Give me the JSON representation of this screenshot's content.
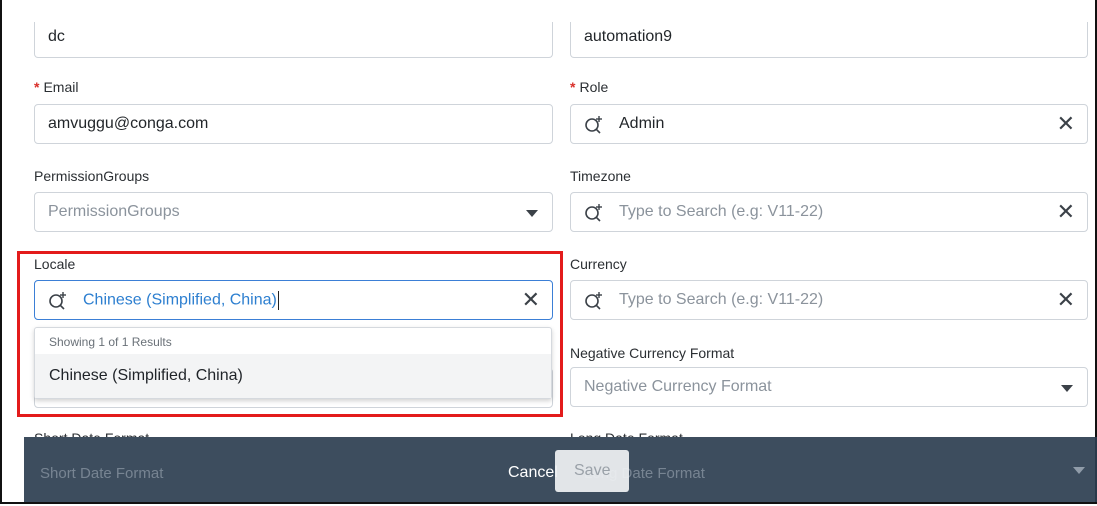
{
  "form": {
    "top_left_value": "dc",
    "top_right_value": "automation9",
    "email": {
      "label": "Email",
      "required_mark": "*",
      "value": "amvuggu@conga.com"
    },
    "role": {
      "label": "Role",
      "required_mark": "*",
      "value": "Admin",
      "clear": "✕"
    },
    "permission_groups": {
      "label": "PermissionGroups",
      "placeholder": "PermissionGroups"
    },
    "timezone": {
      "label": "Timezone",
      "placeholder": "Type to Search (e.g: V11-22)",
      "clear": "✕"
    },
    "locale": {
      "label": "Locale",
      "value": "Chinese (Simplified, China)",
      "clear": "✕"
    },
    "currency": {
      "label": "Currency",
      "placeholder": "Type to Search (e.g: V11-22)",
      "clear": "✕"
    },
    "negative_currency_format": {
      "label": "Negative Currency Format",
      "placeholder": "Negative Currency Format"
    },
    "short_date_format": {
      "label": "Short Date Format",
      "placeholder": "Short Date Format"
    },
    "long_date_format": {
      "label": "Long Date Format",
      "placeholder": "Long Date Format"
    }
  },
  "locale_dropdown": {
    "results_count": "Showing 1 of 1 Results",
    "options": [
      "Chinese (Simplified, China)"
    ]
  },
  "footer": {
    "cancel_label": "Cancel",
    "save_label": "Save"
  },
  "colors": {
    "highlight": "#e31b1b",
    "accent": "#2d7fd0",
    "footer_bg": "#2c3e50",
    "required": "#d9302b"
  },
  "icons": {
    "search": "search-plus-icon",
    "clear": "close-icon",
    "dropdown": "caret-down-icon"
  }
}
